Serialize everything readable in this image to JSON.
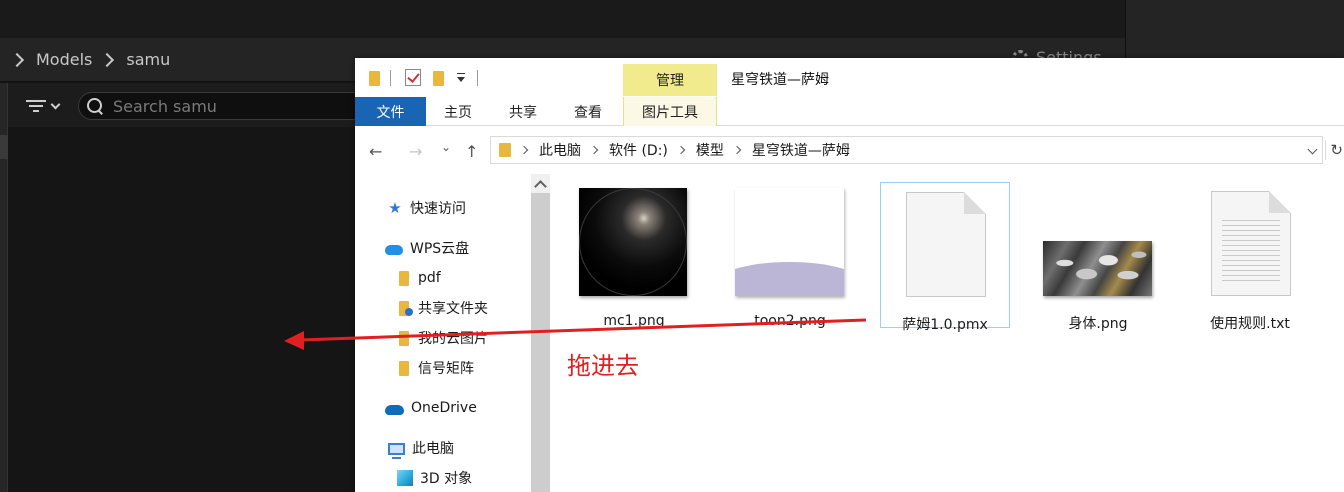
{
  "background_app": {
    "breadcrumb": [
      "Models",
      "samu"
    ],
    "settings_label": "Settings",
    "search": {
      "placeholder": "Search samu",
      "value": ""
    }
  },
  "explorer": {
    "title": "星穹铁道—萨姆",
    "contextual_tab": "管理",
    "ribbon_tabs": [
      {
        "label": "文件",
        "active": true
      },
      {
        "label": "主页",
        "active": false
      },
      {
        "label": "共享",
        "active": false
      },
      {
        "label": "查看",
        "active": false
      },
      {
        "label": "图片工具",
        "active": false
      }
    ],
    "address_path": [
      "此电脑",
      "软件 (D:)",
      "模型",
      "星穹铁道—萨姆"
    ],
    "nav_items": [
      {
        "label": "快速访问",
        "icon": "star-icon"
      },
      {
        "label": "WPS云盘",
        "icon": "cloud-icon"
      },
      {
        "label": "pdf",
        "icon": "folder-icon"
      },
      {
        "label": "共享文件夹",
        "icon": "shared-folder-icon"
      },
      {
        "label": "我的云图片",
        "icon": "folder-icon"
      },
      {
        "label": "信号矩阵",
        "icon": "folder-icon"
      },
      {
        "label": "OneDrive",
        "icon": "onedrive-icon"
      },
      {
        "label": "此电脑",
        "icon": "pc-icon"
      },
      {
        "label": "3D 对象",
        "icon": "3d-objects-icon"
      }
    ],
    "files": [
      {
        "name": "mc1.png",
        "kind": "image",
        "selected": false
      },
      {
        "name": "toon2.png",
        "kind": "image",
        "selected": false
      },
      {
        "name": "萨姆1.0.pmx",
        "kind": "document",
        "selected": true
      },
      {
        "name": "身体.png",
        "kind": "image",
        "selected": false
      },
      {
        "name": "使用规则.txt",
        "kind": "text",
        "selected": false
      }
    ]
  },
  "annotation": {
    "label": "拖进去",
    "color": "#e02020"
  },
  "colors": {
    "ribbon_active": "#1a64b4",
    "manage_tab": "#f1eb8e",
    "selection_border": "#99d1f5",
    "dark_bg": "#151515"
  }
}
